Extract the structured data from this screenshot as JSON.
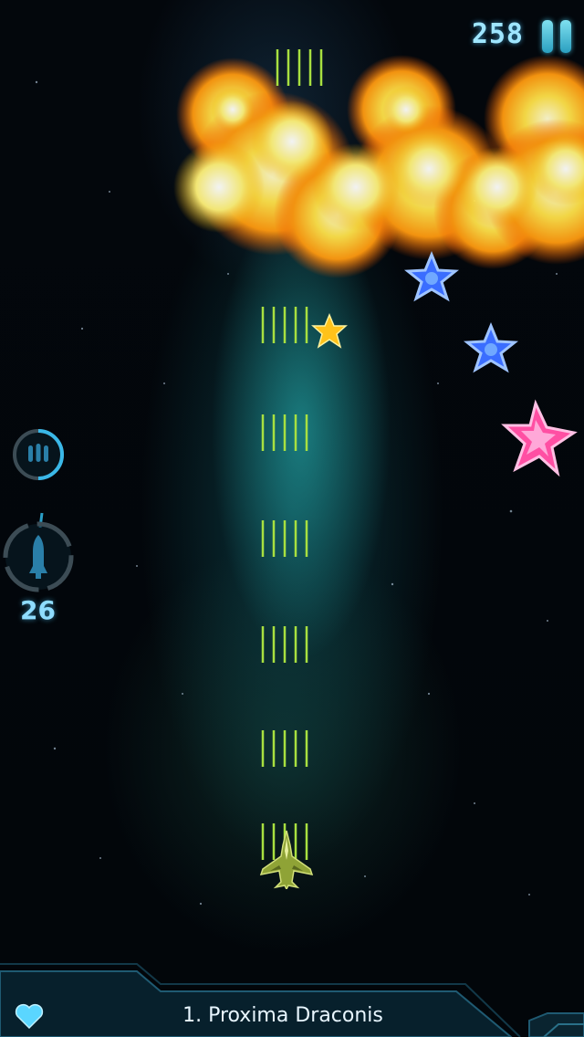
{
  "hud": {
    "score": "258",
    "missile_count": "26",
    "pause_icon": "pause-icon",
    "ability_icon": "triple-shot-icon",
    "missile_icon": "missile-icon"
  },
  "footer": {
    "level_name": "1. Proxima Draconis",
    "life_icon": "heart-icon"
  },
  "colors": {
    "hud_accent": "#8fdcff",
    "bullet": "#a8e040",
    "explosion": "#ffb000",
    "gold_star": "#ffc21a",
    "blue_star": "#3a6dff",
    "pink_star": "#ff4fa3"
  },
  "game": {
    "pickups": [
      "gold-star",
      "blue-star",
      "blue-star",
      "pink-star"
    ]
  }
}
